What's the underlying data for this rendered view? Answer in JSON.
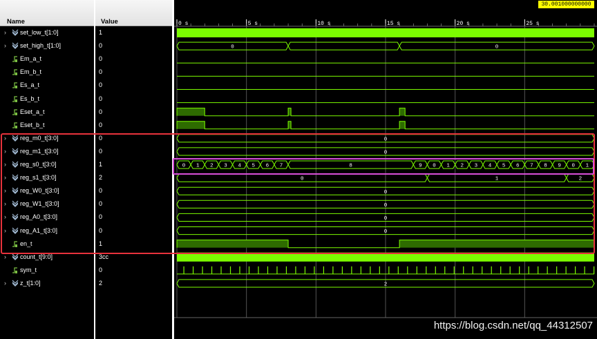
{
  "headers": {
    "name": "Name",
    "value": "Value"
  },
  "cursor_time": "30.001000000000 s",
  "time_ruler": {
    "start": 0,
    "end": 30.0,
    "ticks": [
      {
        "t": 0,
        "label": "0 s"
      },
      {
        "t": 5,
        "label": "5 s"
      },
      {
        "t": 10,
        "label": "10 s"
      },
      {
        "t": 15,
        "label": "15 s"
      },
      {
        "t": 20,
        "label": "20 s"
      },
      {
        "t": 25,
        "label": "25 s"
      }
    ]
  },
  "colors": {
    "wave": "#7CFC00",
    "bus_fill_highlight": "#2e6b00",
    "grid": "#555555",
    "red_box": "#e8323c",
    "magenta_box": "#d94fd9",
    "cursor_bg": "#ffff00"
  },
  "signals": [
    {
      "name": "set_low_t[1:0]",
      "value": "1",
      "kind": "bus",
      "expandable": true,
      "icon": "bus-icon",
      "style": "dense"
    },
    {
      "name": "set_high_t[1:0]",
      "value": "0",
      "kind": "bus",
      "expandable": true,
      "icon": "bus-icon",
      "segments": [
        {
          "from": 0,
          "to": 8,
          "label": "0"
        },
        {
          "from": 8,
          "to": 16,
          "label": ""
        },
        {
          "from": 16,
          "to": 30,
          "label": "0"
        }
      ]
    },
    {
      "name": "Em_a_t",
      "value": "0",
      "kind": "bit",
      "expandable": false,
      "icon": "bit-icon",
      "pulses": []
    },
    {
      "name": "Em_b_t",
      "value": "0",
      "kind": "bit",
      "expandable": false,
      "icon": "bit-icon",
      "pulses": []
    },
    {
      "name": "Es_a_t",
      "value": "0",
      "kind": "bit",
      "expandable": false,
      "icon": "bit-icon",
      "pulses": []
    },
    {
      "name": "Es_b_t",
      "value": "0",
      "kind": "bit",
      "expandable": false,
      "icon": "bit-icon",
      "pulses": []
    },
    {
      "name": "Eset_a_t",
      "value": "0",
      "kind": "bit",
      "expandable": false,
      "icon": "bit-icon",
      "pulses": [
        [
          0,
          2
        ],
        [
          8,
          8.2
        ],
        [
          16,
          16.4
        ]
      ]
    },
    {
      "name": "Eset_b_t",
      "value": "0",
      "kind": "bit",
      "expandable": false,
      "icon": "bit-icon",
      "pulses": [
        [
          0,
          2
        ],
        [
          8,
          8.2
        ],
        [
          16,
          16.4
        ]
      ]
    },
    {
      "name": "reg_m0_t[3:0]",
      "value": "0",
      "kind": "bus",
      "expandable": true,
      "icon": "bus-icon",
      "segments": [
        {
          "from": 0,
          "to": 30,
          "label": "0"
        }
      ]
    },
    {
      "name": "reg_m1_t[3:0]",
      "value": "0",
      "kind": "bus",
      "expandable": true,
      "icon": "bus-icon",
      "segments": [
        {
          "from": 0,
          "to": 30,
          "label": "0"
        }
      ]
    },
    {
      "name": "reg_s0_t[3:0]",
      "value": "1",
      "kind": "bus",
      "expandable": true,
      "icon": "bus-icon",
      "segments": [
        {
          "from": 0,
          "to": 1,
          "label": "0"
        },
        {
          "from": 1,
          "to": 2,
          "label": "1"
        },
        {
          "from": 2,
          "to": 3,
          "label": "2"
        },
        {
          "from": 3,
          "to": 4,
          "label": "3"
        },
        {
          "from": 4,
          "to": 5,
          "label": "4"
        },
        {
          "from": 5,
          "to": 6,
          "label": "5"
        },
        {
          "from": 6,
          "to": 7,
          "label": "6"
        },
        {
          "from": 7,
          "to": 8,
          "label": "7"
        },
        {
          "from": 8,
          "to": 17,
          "label": "8"
        },
        {
          "from": 17,
          "to": 18,
          "label": "9"
        },
        {
          "from": 18,
          "to": 19,
          "label": "0"
        },
        {
          "from": 19,
          "to": 20,
          "label": "1"
        },
        {
          "from": 20,
          "to": 21,
          "label": "2"
        },
        {
          "from": 21,
          "to": 22,
          "label": "3"
        },
        {
          "from": 22,
          "to": 23,
          "label": "4"
        },
        {
          "from": 23,
          "to": 24,
          "label": "5"
        },
        {
          "from": 24,
          "to": 25,
          "label": "6"
        },
        {
          "from": 25,
          "to": 26,
          "label": "7"
        },
        {
          "from": 26,
          "to": 27,
          "label": "8"
        },
        {
          "from": 27,
          "to": 28,
          "label": "9"
        },
        {
          "from": 28,
          "to": 29,
          "label": "0"
        },
        {
          "from": 29,
          "to": 30,
          "label": "1"
        }
      ]
    },
    {
      "name": "reg_s1_t[3:0]",
      "value": "2",
      "kind": "bus",
      "expandable": true,
      "icon": "bus-icon",
      "segments": [
        {
          "from": 0,
          "to": 18,
          "label": "0"
        },
        {
          "from": 18,
          "to": 28,
          "label": "1"
        },
        {
          "from": 28,
          "to": 30,
          "label": "2"
        }
      ]
    },
    {
      "name": "reg_W0_t[3:0]",
      "value": "0",
      "kind": "bus",
      "expandable": true,
      "icon": "bus-icon",
      "segments": [
        {
          "from": 0,
          "to": 30,
          "label": "0"
        }
      ]
    },
    {
      "name": "reg_W1_t[3:0]",
      "value": "0",
      "kind": "bus",
      "expandable": true,
      "icon": "bus-icon",
      "segments": [
        {
          "from": 0,
          "to": 30,
          "label": "0"
        }
      ]
    },
    {
      "name": "reg_A0_t[3:0]",
      "value": "0",
      "kind": "bus",
      "expandable": true,
      "icon": "bus-icon",
      "segments": [
        {
          "from": 0,
          "to": 30,
          "label": "0"
        }
      ]
    },
    {
      "name": "reg_A1_t[3:0]",
      "value": "0",
      "kind": "bus",
      "expandable": true,
      "icon": "bus-icon",
      "segments": [
        {
          "from": 0,
          "to": 30,
          "label": "0"
        }
      ]
    },
    {
      "name": "en_t",
      "value": "1",
      "kind": "bit",
      "expandable": false,
      "icon": "bit-icon",
      "pulses": [
        [
          0,
          8
        ],
        [
          16,
          30
        ]
      ]
    },
    {
      "name": "count_t[9:0]",
      "value": "3cc",
      "kind": "bus",
      "expandable": true,
      "icon": "bus-icon",
      "style": "dense"
    },
    {
      "name": "sym_t",
      "value": "0",
      "kind": "bit",
      "expandable": false,
      "icon": "bit-icon",
      "style": "clock"
    },
    {
      "name": "z_t[1:0]",
      "value": "2",
      "kind": "bus",
      "expandable": true,
      "icon": "bus-icon",
      "segments": [
        {
          "from": 0,
          "to": 30,
          "label": "2"
        }
      ]
    }
  ],
  "watermark": "https://blog.csdn.net/qq_44312507"
}
